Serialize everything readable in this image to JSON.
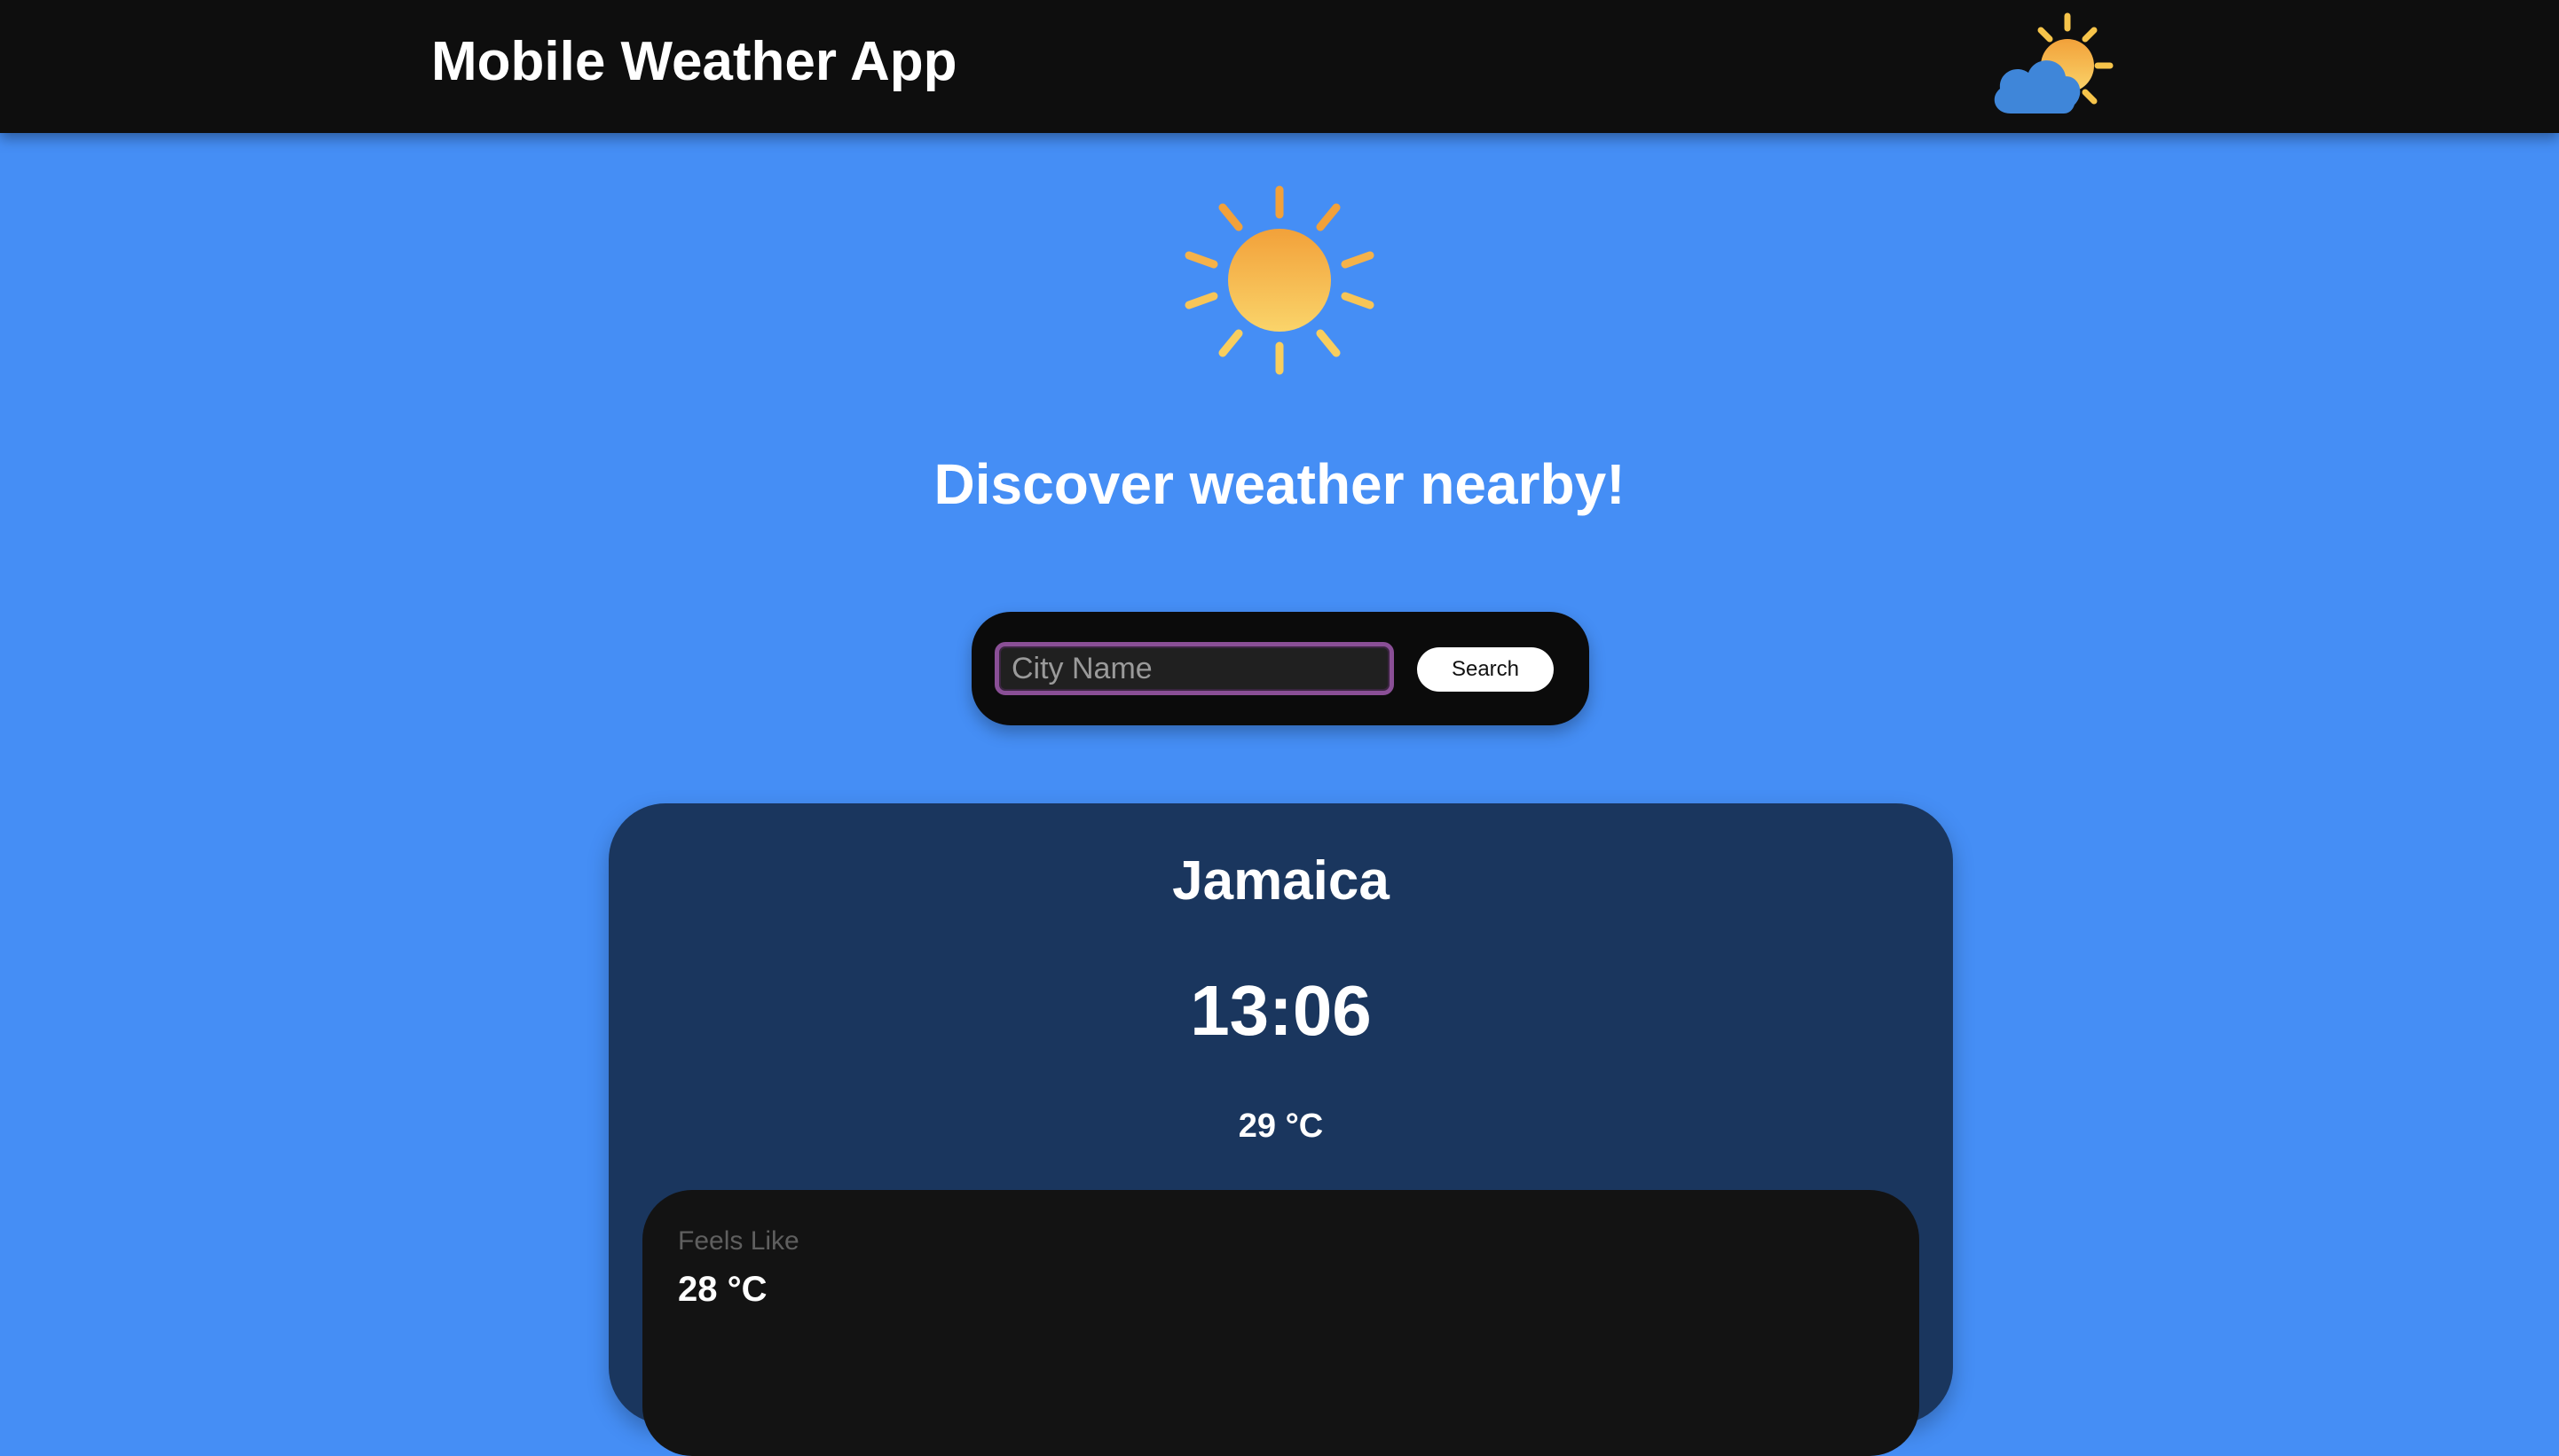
{
  "header": {
    "title": "Mobile Weather App",
    "logo_icon": "partly-cloudy-icon"
  },
  "hero": {
    "icon": "sun-icon",
    "tagline": "Discover weather nearby!"
  },
  "search": {
    "placeholder": "City Name",
    "value": "",
    "button_label": "Search"
  },
  "weather": {
    "city": "Jamaica",
    "time": "13:06",
    "temperature": "29 °C",
    "details": {
      "feels_like_label": "Feels Like",
      "feels_like_value": "28 °C"
    }
  },
  "colors": {
    "background": "#458ef5",
    "header": "#0e0e0e",
    "card": "#1a365e",
    "panel": "#131313",
    "sun_top": "#f2a13a",
    "sun_bottom": "#fad46a",
    "cloud": "#3f86d9",
    "input_focus_border": "#8a4f96"
  }
}
